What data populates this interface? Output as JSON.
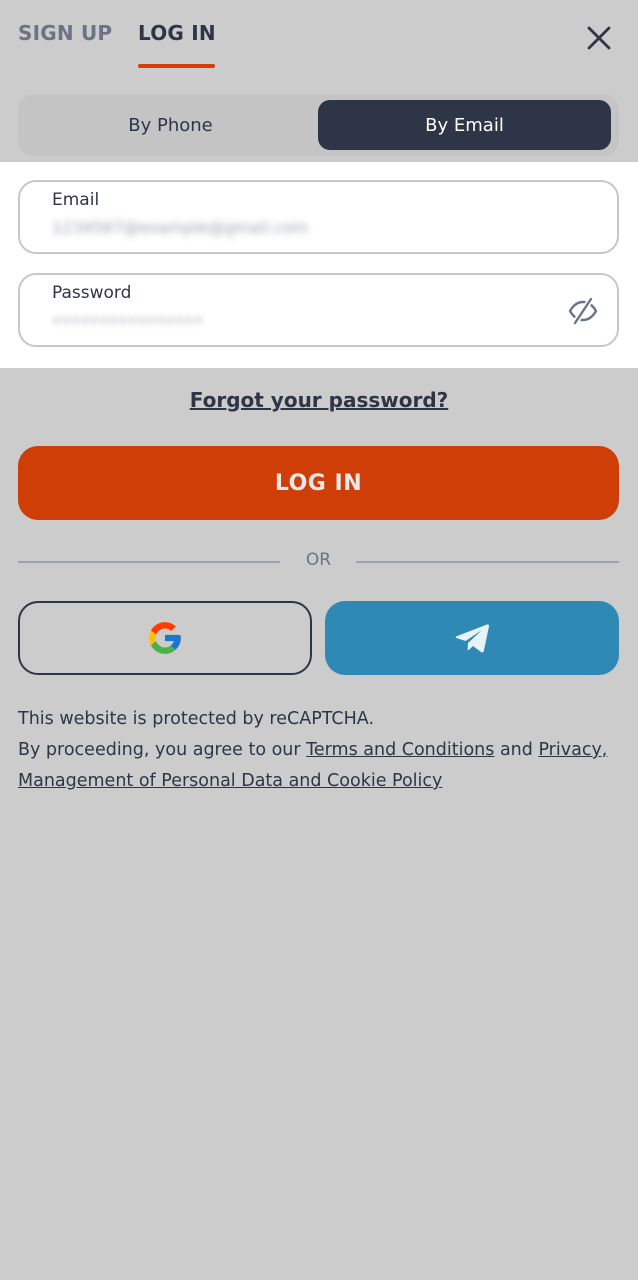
{
  "tabs": {
    "signup": "SIGN UP",
    "login": "LOG IN"
  },
  "method": {
    "phone": "By Phone",
    "email": "By Email"
  },
  "fields": {
    "email_label": "Email",
    "email_value": "1234567@example@gmail.com",
    "password_label": "Password",
    "password_value": "••••••••••••••••"
  },
  "forgot": "Forgot your password?",
  "login_button": "LOG IN",
  "or": "OR",
  "legal": {
    "line1": "This website is protected by reCAPTCHA.",
    "line2_prefix": "By proceeding, you agree to our ",
    "terms": "Terms and Conditions",
    "and": " and ",
    "privacy": "Privacy,",
    "privacy_cont": "Management of Personal Data and Cookie Policy"
  },
  "colors": {
    "accent": "#cf3e06",
    "dark": "#2e3547",
    "telegram": "#2e89b5",
    "background": "#cccccc"
  },
  "icons": {
    "close": "close-icon",
    "eye": "eye-off-icon",
    "google": "google-icon",
    "telegram": "telegram-icon"
  }
}
